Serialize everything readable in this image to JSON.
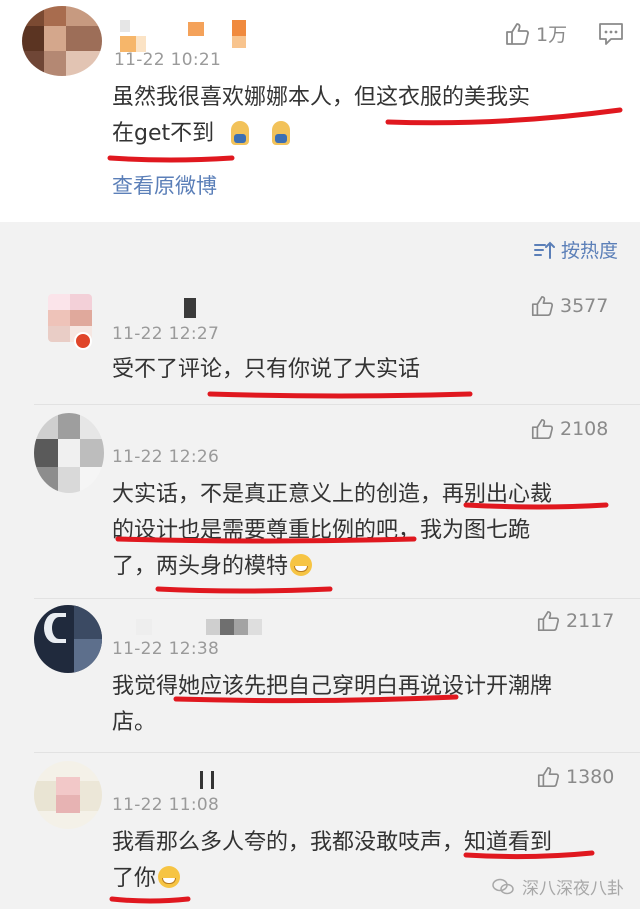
{
  "top_comment": {
    "timestamp": "11-22 10:21",
    "text_line1": "虽然我很喜欢娜娜本人，但这衣服的美我实",
    "text_line2": "在get不到",
    "like_count": "1万",
    "view_original": "查看原微博"
  },
  "sort": {
    "label": "按热度"
  },
  "comments": [
    {
      "timestamp": "11-22 12:27",
      "likes": "3577",
      "lines": [
        "受不了评论，只有你说了大实话"
      ]
    },
    {
      "timestamp": "11-22 12:26",
      "likes": "2108",
      "lines": [
        "大实话，不是真正意义上的创造，再别出心裁",
        "的设计也是需要尊重比例的吧，我为图七跪",
        "了，两头身的模特"
      ]
    },
    {
      "timestamp": "11-22 12:38",
      "likes": "2117",
      "lines": [
        "我觉得她应该先把自己穿明白再说设计开潮牌",
        "店。"
      ]
    },
    {
      "timestamp": "11-22 11:08",
      "likes": "1380",
      "lines": [
        "我看那么多人夸的，我都没敢吱声，知道看到",
        "了你"
      ]
    }
  ],
  "watermark": {
    "text": "深八深夜八卦"
  },
  "colors": {
    "link": "#5b7fb8",
    "underline": "#e0181f",
    "text": "#333333",
    "meta": "#9a9a9a"
  }
}
